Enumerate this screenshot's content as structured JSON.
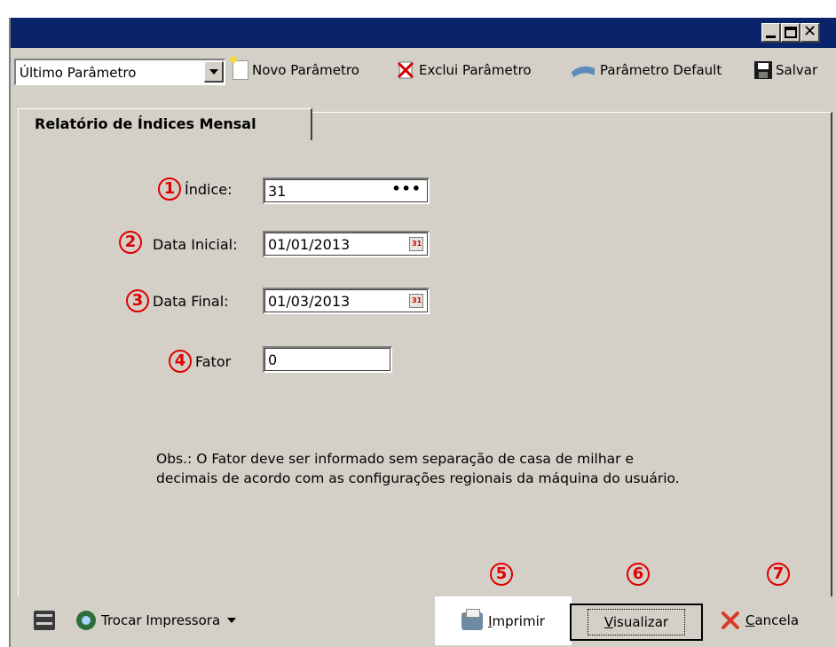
{
  "window": {
    "buttons": {
      "minimize": "_",
      "maximize": "□",
      "close": "✕"
    }
  },
  "toolbar": {
    "combo_value": "Último Parâmetro",
    "new_label": "Novo Parâmetro",
    "delete_label": "Exclui Parâmetro",
    "default_label": "Parâmetro Default",
    "save_label": "Salvar"
  },
  "tab": {
    "label": "Relatório de Índices Mensal"
  },
  "form": {
    "indice": {
      "number": "1",
      "label": "Índice:",
      "value": "31",
      "ellipsis": "•••"
    },
    "data_inicial": {
      "number": "2",
      "label": "Data Inicial:",
      "value": "01/01/2013"
    },
    "data_final": {
      "number": "3",
      "label": "Data Final:",
      "value": "01/03/2013"
    },
    "fator": {
      "number": "4",
      "label": "Fator",
      "value": "0"
    }
  },
  "obs": "Obs.: O Fator deve ser informado sem separação de casa de milhar e decimais de acordo com as configurações regionais da máquina do usuário.",
  "bottom": {
    "change_printer": "Trocar Impressora",
    "print": {
      "number": "5",
      "accel": "I",
      "rest": "mprimir"
    },
    "preview": {
      "number": "6",
      "accel": "V",
      "rest": "isualizar"
    },
    "cancel": {
      "number": "7",
      "accel": "C",
      "rest": "ancela"
    }
  },
  "colors": {
    "titlebar": "#0a246a",
    "face": "#d4d0c8",
    "annotation_red": "#e00000"
  }
}
